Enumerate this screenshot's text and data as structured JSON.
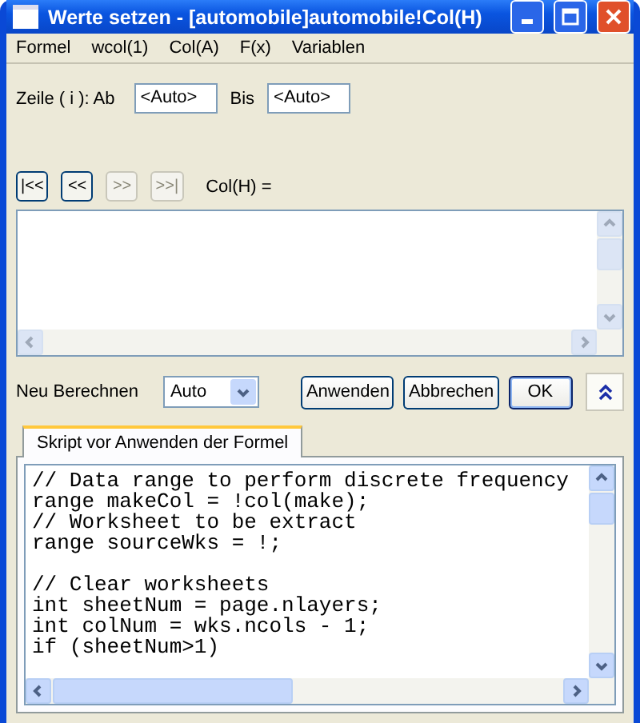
{
  "window": {
    "title": "Werte setzen - [automobile]automobile!Col(H)"
  },
  "menu": [
    "Formel",
    "wcol(1)",
    "Col(A)",
    "F(x)",
    "Variablen"
  ],
  "row_range": {
    "label": "Zeile ( i ): Ab",
    "from": "<Auto>",
    "to_label": "Bis",
    "to": "<Auto>"
  },
  "nav_buttons": [
    {
      "label": "|<<",
      "disabled": false
    },
    {
      "label": "<<",
      "disabled": false
    },
    {
      "label": ">>",
      "disabled": true
    },
    {
      "label": ">>|",
      "disabled": true
    }
  ],
  "formula_label": "Col(H) =",
  "recalc": {
    "label": "Neu Berechnen",
    "value": "Auto"
  },
  "buttons": [
    "Anwenden",
    "Abbrechen",
    "OK"
  ],
  "tabs": [
    {
      "label": "Skript vor Anwenden der Formel",
      "selected": true
    }
  ],
  "script_blocks": [
    [
      "// Data range to perform discrete frequency",
      "range makeCol = !col(make);",
      "// Worksheet to be extract",
      "range sourceWks = !;"
    ],
    [
      "// Clear worksheets",
      "int sheetNum = page.nlayers;",
      "int colNum = wks.ncols - 1;",
      "if (sheetNum>1)"
    ]
  ]
}
